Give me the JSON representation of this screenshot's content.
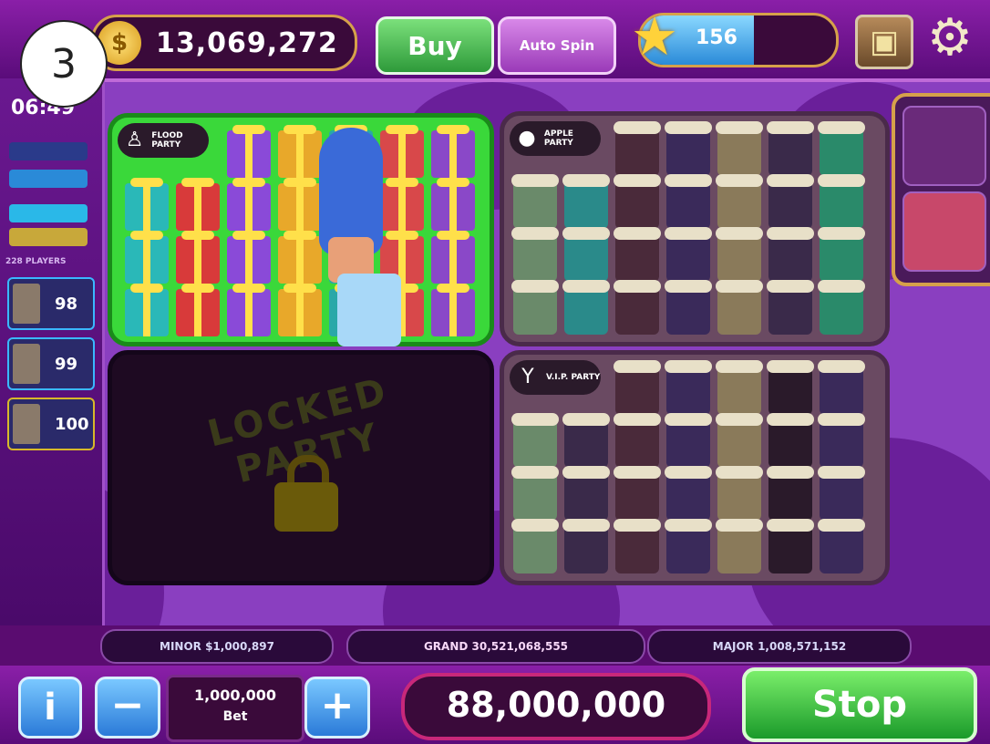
{
  "step_badge": "3",
  "header": {
    "coin_balance": "13,069,272",
    "buy_label": "Buy",
    "auto_label": "Auto Spin",
    "level_value": "156",
    "level_progress": 0.58
  },
  "sidebar": {
    "timer": "06:49",
    "players_label": "228 PLAYERS",
    "player_scores": [
      "98",
      "99",
      "100"
    ]
  },
  "boards": [
    {
      "name": "FLOOD PARTY",
      "state": "active"
    },
    {
      "name": "APPLE PARTY",
      "state": "active"
    },
    {
      "name": "LOCKED PARTY",
      "state": "locked"
    },
    {
      "name": "V.I.P. PARTY",
      "state": "active"
    }
  ],
  "jackpots": {
    "minor": "MINOR  $1,000,897",
    "grand": "GRAND  30,521,068,555",
    "major": "MAJOR  1,008,571,152"
  },
  "footer": {
    "info_label": "i",
    "bet_value": "1,000,000",
    "bet_label": "Bet",
    "win_amount": "88,000,000",
    "stop_label": "Stop"
  }
}
